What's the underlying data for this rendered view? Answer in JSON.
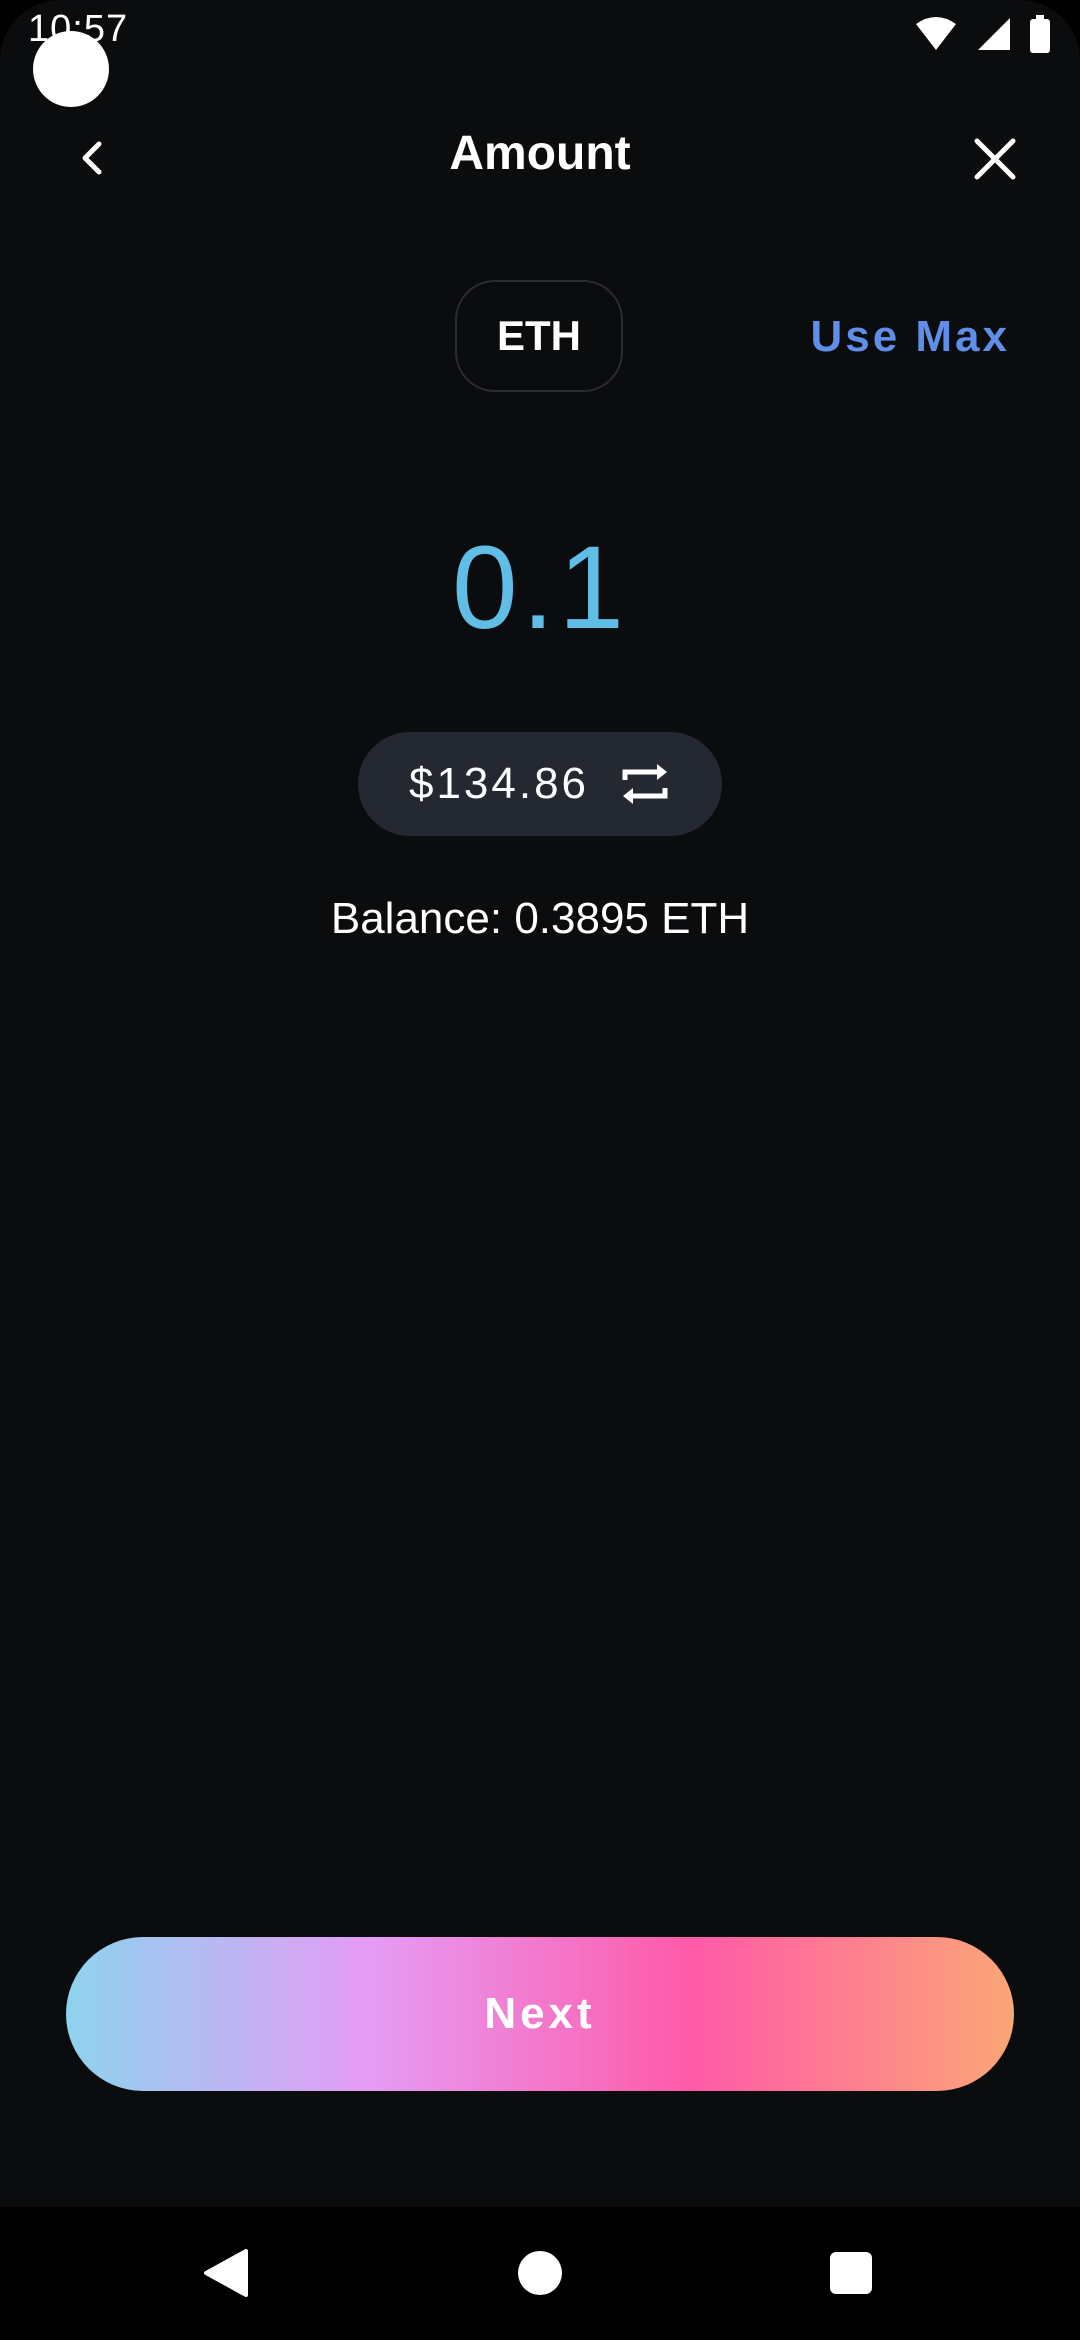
{
  "status_bar": {
    "time": "10:57",
    "icons": [
      "wifi-icon",
      "signal-icon",
      "battery-icon"
    ]
  },
  "header": {
    "title": "Amount",
    "back_icon": "chevron-left-icon",
    "close_icon": "close-icon"
  },
  "token": {
    "symbol": "ETH"
  },
  "use_max_label": "Use Max",
  "amount": {
    "value": "0.1",
    "fiat": "$134.86",
    "swap_icon": "swap-icon"
  },
  "balance_text": "Balance: 0.3895 ETH",
  "next_label": "Next",
  "nav_bar": {
    "items": [
      "back-icon",
      "home-icon",
      "recents-icon"
    ]
  },
  "colors": {
    "background": "#0b0c0e",
    "accent_link": "#5f8fe8",
    "amount": "#5fbde6",
    "pill": "#242931",
    "gradient": [
      "#8dd3ee",
      "#e59cf5",
      "#ff5aa8",
      "#fba676"
    ]
  }
}
